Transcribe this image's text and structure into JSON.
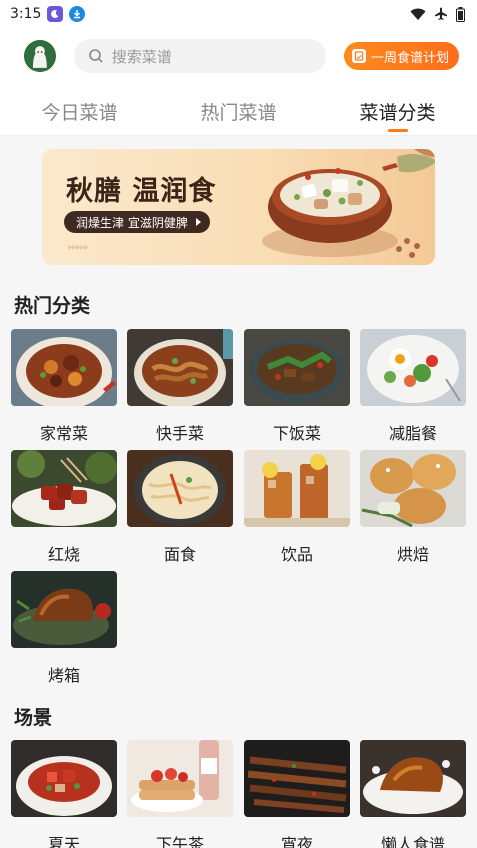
{
  "status_bar": {
    "time": "3:15"
  },
  "header": {
    "search_placeholder": "搜索菜谱",
    "plan_button": "一周食谱计划"
  },
  "tabs": [
    {
      "label": "今日菜谱",
      "active": false
    },
    {
      "label": "热门菜谱",
      "active": false
    },
    {
      "label": "菜谱分类",
      "active": true
    }
  ],
  "banner": {
    "title": "秋膳 温润食",
    "tag": "润燥生津  宜滋阴健脾"
  },
  "hot_categories": {
    "title": "热门分类",
    "items": [
      {
        "label": "家常菜"
      },
      {
        "label": "快手菜"
      },
      {
        "label": "下饭菜"
      },
      {
        "label": "减脂餐"
      },
      {
        "label": "红烧"
      },
      {
        "label": "面食"
      },
      {
        "label": "饮品"
      },
      {
        "label": "烘焙"
      },
      {
        "label": "烤箱"
      }
    ]
  },
  "scenes": {
    "title": "场景",
    "items": [
      {
        "label": "夏天"
      },
      {
        "label": "下午茶"
      },
      {
        "label": "宵夜"
      },
      {
        "label": "懒人食谱"
      }
    ]
  },
  "colors": {
    "accent": "#ff7a1a",
    "tag_bg": "#3f2a22",
    "banner_bg": "#f9deb6"
  }
}
